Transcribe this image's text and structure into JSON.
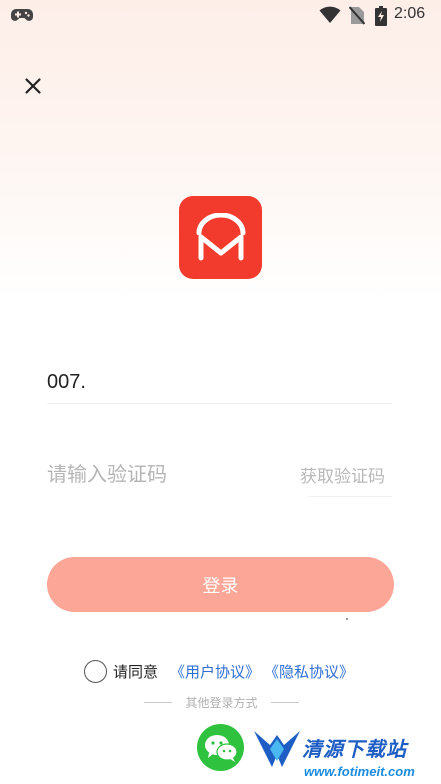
{
  "status_bar": {
    "time": "2:06",
    "icons": [
      "gamepad-icon",
      "wifi-icon",
      "no-sim-icon",
      "battery-charging-icon"
    ]
  },
  "header": {
    "close_icon": "close-icon"
  },
  "logo": {
    "name": "app-logo",
    "color": "#f23b2c"
  },
  "form": {
    "phone_value": "007.",
    "code_placeholder": "请输入验证码",
    "code_value": "",
    "get_code_label": "获取验证码",
    "login_label": "登录"
  },
  "agreement": {
    "prefix": "请同意",
    "user_agreement": "《用户协议》",
    "privacy_policy": "《隐私协议》",
    "checked": false
  },
  "other_login": {
    "label": "其他登录方式",
    "wechat_icon": "wechat-icon"
  },
  "watermark": {
    "text": "清源下载站",
    "url": "www.fotimeit.com"
  },
  "colors": {
    "accent": "#f23b2c",
    "button": "#fba696",
    "link": "#2e6fd3",
    "wechat": "#2ec23e"
  }
}
